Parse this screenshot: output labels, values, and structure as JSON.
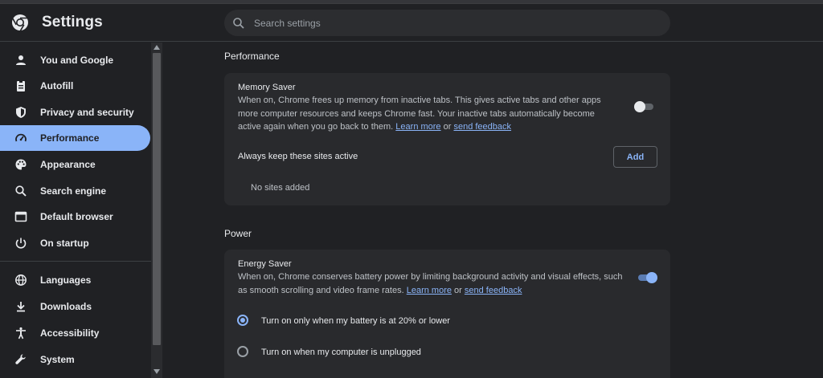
{
  "header": {
    "app_title": "Settings",
    "search_placeholder": "Search settings"
  },
  "sidebar": {
    "items": [
      {
        "label": "You and Google",
        "icon": "person-icon"
      },
      {
        "label": "Autofill",
        "icon": "clipboard-icon"
      },
      {
        "label": "Privacy and security",
        "icon": "shield-icon"
      },
      {
        "label": "Performance",
        "icon": "speedometer-icon",
        "active": true
      },
      {
        "label": "Appearance",
        "icon": "palette-icon"
      },
      {
        "label": "Search engine",
        "icon": "search-icon"
      },
      {
        "label": "Default browser",
        "icon": "browser-window-icon"
      },
      {
        "label": "On startup",
        "icon": "power-icon"
      },
      {
        "label": "Languages",
        "icon": "globe-icon"
      },
      {
        "label": "Downloads",
        "icon": "download-icon"
      },
      {
        "label": "Accessibility",
        "icon": "accessibility-icon"
      },
      {
        "label": "System",
        "icon": "wrench-icon"
      }
    ]
  },
  "performance": {
    "section_title": "Performance",
    "memory_saver": {
      "title": "Memory Saver",
      "description": "When on, Chrome frees up memory from inactive tabs. This gives active tabs and other apps more computer resources and keeps Chrome fast. Your inactive tabs automatically become active again when you go back to them.",
      "learn_more": "Learn more",
      "or_text": "or",
      "send_feedback": "send feedback",
      "enabled": false
    },
    "always_active": {
      "title": "Always keep these sites active",
      "add_label": "Add",
      "empty_text": "No sites added"
    }
  },
  "power": {
    "section_title": "Power",
    "energy_saver": {
      "title": "Energy Saver",
      "description": "When on, Chrome conserves battery power by limiting background activity and visual effects, such as smooth scrolling and video frame rates.",
      "learn_more": "Learn more",
      "or_text": "or",
      "send_feedback": "send feedback",
      "enabled": true
    },
    "options": [
      {
        "label": "Turn on only when my battery is at 20% or lower",
        "checked": true
      },
      {
        "label": "Turn on when my computer is unplugged",
        "checked": false
      }
    ]
  },
  "colors": {
    "background": "#202124",
    "card": "#292a2d",
    "accent": "#8ab4f8",
    "text": "#e8eaed"
  }
}
